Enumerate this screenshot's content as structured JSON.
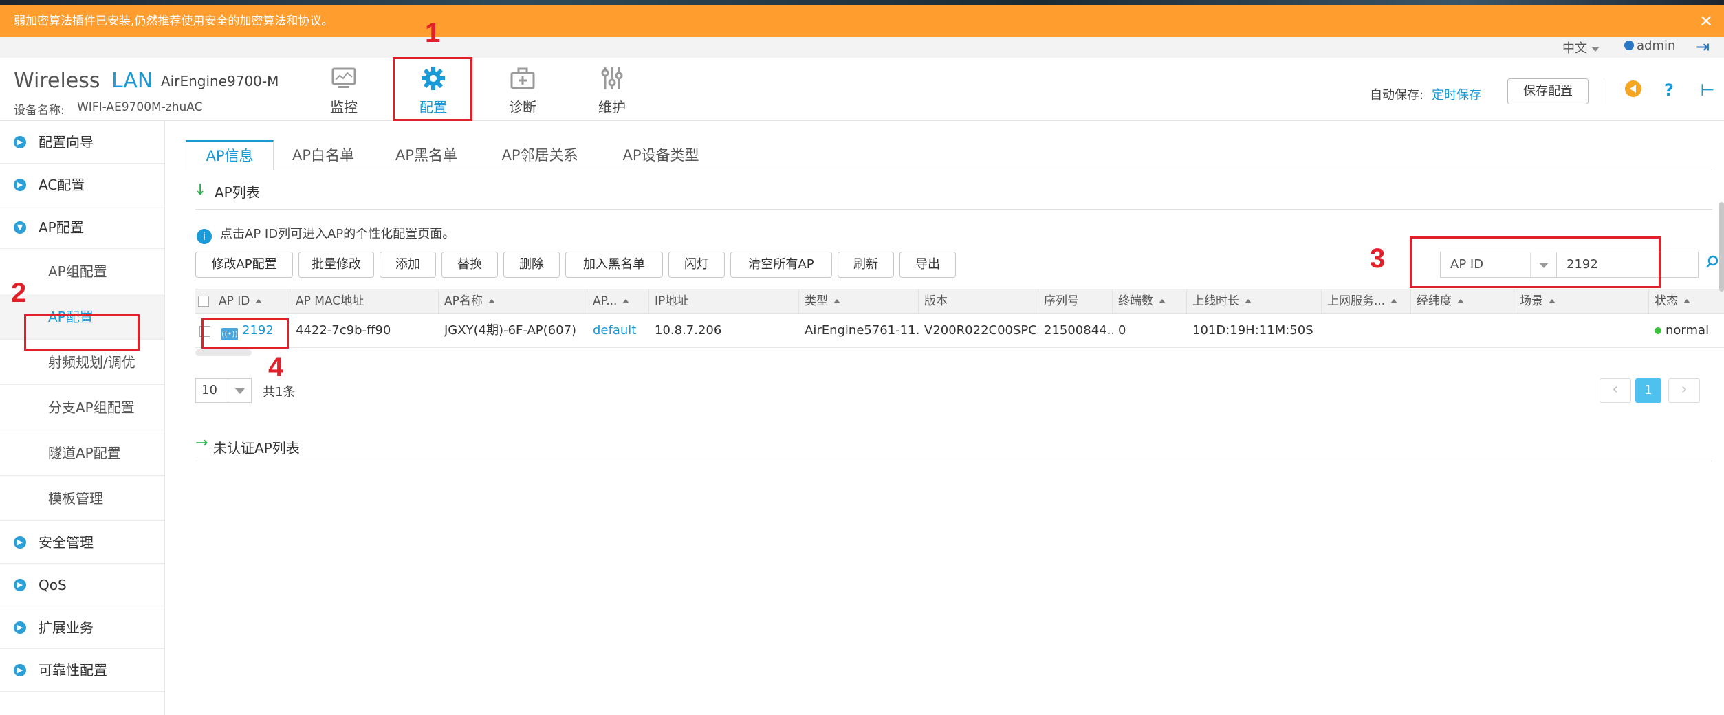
{
  "warning": {
    "text": "弱加密算法插件已安装,仍然推荐使用安全的加密算法和协议。",
    "close": "✕"
  },
  "userbar": {
    "language": "中文",
    "user": "admin"
  },
  "header": {
    "brand_part1": "Wireless",
    "brand_part2": "LAN",
    "model": "AirEngine9700-M",
    "device_label": "设备名称:",
    "device_name": "WIFI-AE9700M-zhuAC",
    "nav": [
      {
        "label": "监控",
        "icon": "monitor-icon"
      },
      {
        "label": "配置",
        "icon": "gear-icon",
        "active": true
      },
      {
        "label": "诊断",
        "icon": "toolbox-icon"
      },
      {
        "label": "维护",
        "icon": "sliders-icon"
      }
    ],
    "autosave_label": "自动保存:",
    "autosave_link": "定时保存",
    "save_button": "保存配置"
  },
  "sidebar": {
    "items": [
      {
        "label": "配置向导"
      },
      {
        "label": "AC配置"
      },
      {
        "label": "AP配置",
        "expanded": true
      },
      {
        "label": "AP组配置",
        "sub": true
      },
      {
        "label": "AP配置",
        "sub": true,
        "active": true
      },
      {
        "label": "射频规划/调优",
        "sub": true
      },
      {
        "label": "分支AP组配置",
        "sub": true
      },
      {
        "label": "隧道AP配置",
        "sub": true
      },
      {
        "label": "模板管理",
        "sub": true
      },
      {
        "label": "安全管理"
      },
      {
        "label": "QoS"
      },
      {
        "label": "扩展业务"
      },
      {
        "label": "可靠性配置"
      }
    ]
  },
  "tabs": [
    "AP信息",
    "AP白名单",
    "AP黑名单",
    "AP邻居关系",
    "AP设备类型"
  ],
  "ap_list": {
    "title": "AP列表",
    "info": "点击AP ID列可进入AP的个性化配置页面。",
    "buttons": [
      "修改AP配置",
      "批量修改",
      "添加",
      "替换",
      "删除",
      "加入黑名单",
      "闪灯",
      "清空所有AP",
      "刷新",
      "导出"
    ],
    "search": {
      "field": "AP ID",
      "value": "2192"
    },
    "columns": [
      "AP ID",
      "AP MAC地址",
      "AP名称",
      "AP...",
      "IP地址",
      "类型",
      "版本",
      "序列号",
      "终端数",
      "上线时长",
      "上网服务...",
      "经纬度",
      "场景",
      "状态"
    ],
    "rows": [
      {
        "ap_id": "2192",
        "mac": "4422-7c9b-ff90",
        "name": "JGXY(4期)-6F-AP(607)",
        "group": "default",
        "ip": "10.8.7.206",
        "type": "AirEngine5761-11...",
        "version": "V200R022C00SPC...",
        "serial": "21500844...",
        "clients": "0",
        "uptime": "101D:19H:11M:50S",
        "service": "",
        "latlon": "",
        "scene": "",
        "status": "normal"
      }
    ],
    "page_size": "10",
    "total": "共1条",
    "page": "1"
  },
  "unauth_list": {
    "title": "未认证AP列表"
  },
  "annotations": [
    "1",
    "2",
    "3",
    "4"
  ],
  "colors": {
    "accent": "#1a9ad6",
    "warning": "#ff9d2e",
    "annotation": "#e2202a",
    "status_ok": "#3cc13c"
  }
}
